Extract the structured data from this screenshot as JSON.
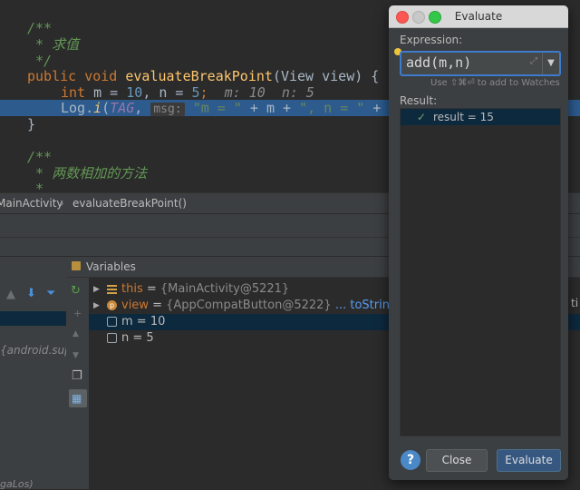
{
  "editor": {
    "comment1": "/**",
    "comment2": " * 求值",
    "comment3": " */",
    "sig_public": "public ",
    "sig_void": "void ",
    "sig_name": "evaluateBreakPoint",
    "sig_params": "(View view) {",
    "line_int": "int ",
    "line_m": "m = ",
    "line_10": "10",
    "line_n": ", n = ",
    "line_5": "5",
    "line_semi": ";",
    "inline_hint": "m: 10  n: 5",
    "log_call": "Log.",
    "log_i": "i",
    "log_open": "(",
    "log_tag": "TAG",
    "log_comma": ", ",
    "param_hint": "msg:",
    "log_str1": "\"m = \"",
    "log_rest": " + m + ",
    "log_str2": "\", n = \"",
    "log_plus": " +",
    "close_brace": "}",
    "comment4": "/**",
    "comment5": " * 两数相加的方法",
    "comment6": " *"
  },
  "breadcrumb": {
    "class_name": "MainActivity",
    "separator": "›",
    "method": "evaluateBreakPoint()"
  },
  "frames": {
    "partial_text": "{android.sup",
    "partial_text2": "gaLos)"
  },
  "variables": {
    "header": "Variables",
    "rows": [
      {
        "name": "this",
        "eq": " = ",
        "value": "{MainActivity@5221}"
      },
      {
        "name": "view",
        "eq": " = ",
        "value": "{AppCompatButton@5222}",
        "extra": "... toString()"
      },
      {
        "name": "m",
        "eq": " = ",
        "value": "10"
      },
      {
        "name": "n",
        "eq": " = ",
        "value": "5"
      }
    ],
    "right_cut": "ti"
  },
  "dialog": {
    "title": "Evaluate",
    "expression_label": "Expression:",
    "expression_value": "add(m,n)",
    "watch_hint": "Use ⇧⌘⏎ to add to Watches",
    "result_label": "Result:",
    "result_value": "result = 15",
    "close_label": "Close",
    "evaluate_label": "Evaluate",
    "help_label": "?"
  },
  "colors": {
    "accent": "#3d7bcc",
    "selection": "#0d293e",
    "editor_bg": "#2b2b2b"
  }
}
